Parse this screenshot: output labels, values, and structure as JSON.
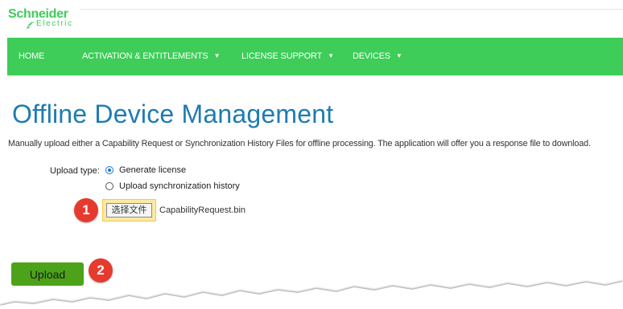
{
  "brand": {
    "name_top": "Schneider",
    "name_bottom": "Electric"
  },
  "nav": {
    "items": [
      {
        "label": "HOME",
        "has_dropdown": false
      },
      {
        "label": "ACTIVATION & ENTITLEMENTS",
        "has_dropdown": true
      },
      {
        "label": "LICENSE SUPPORT",
        "has_dropdown": true
      },
      {
        "label": "DEVICES",
        "has_dropdown": true
      }
    ],
    "caret": "▼"
  },
  "main": {
    "title": "Offline Device Management",
    "description": "Manually upload either a Capability Request or Synchronization History Files for offline processing. The application will offer you a response file to download.",
    "upload_type": {
      "label": "Upload type:",
      "options": [
        {
          "label": "Generate license",
          "checked": true
        },
        {
          "label": "Upload synchronization history",
          "checked": false
        }
      ]
    },
    "file": {
      "button_label": "选择文件",
      "file_name": "CapabilityRequest.bin"
    },
    "upload_button": "Upload"
  },
  "annotations": {
    "step1": "1",
    "step2": "2"
  },
  "colors": {
    "brand_green": "#3dcd58",
    "title_blue": "#1e7bb3",
    "upload_button": "#4ca319",
    "badge_red": "#e63a2e",
    "highlight_yellow": "#fde9a3"
  }
}
